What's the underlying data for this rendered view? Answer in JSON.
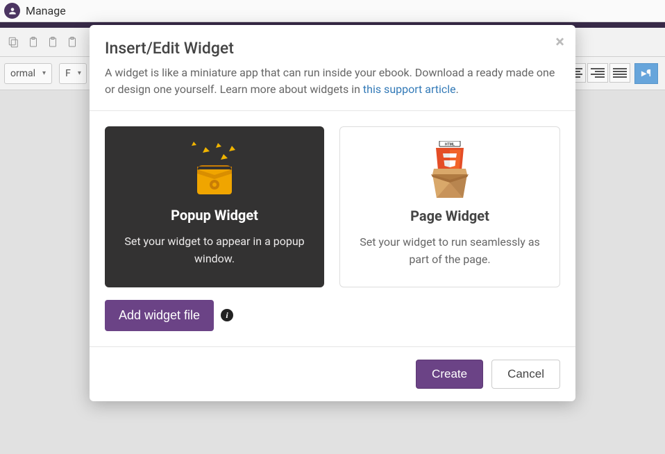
{
  "topbar": {
    "manage": "Manage"
  },
  "toolbar": {
    "format_dropdown_partial": "ormal",
    "font_dropdown_partial": "F"
  },
  "modal": {
    "title": "Insert/Edit Widget",
    "description_before": "A widget is like a miniature app that can run inside your ebook. Download a ready made one or design one yourself. Learn more about widgets in ",
    "link_text": "this support article",
    "description_after": ".",
    "popup": {
      "title": "Popup Widget",
      "desc": "Set your widget to appear in a popup window."
    },
    "page": {
      "title": "Page Widget",
      "desc": "Set your widget to run seamlessly as part of the page."
    },
    "add_button": "Add widget file",
    "create": "Create",
    "cancel": "Cancel"
  }
}
